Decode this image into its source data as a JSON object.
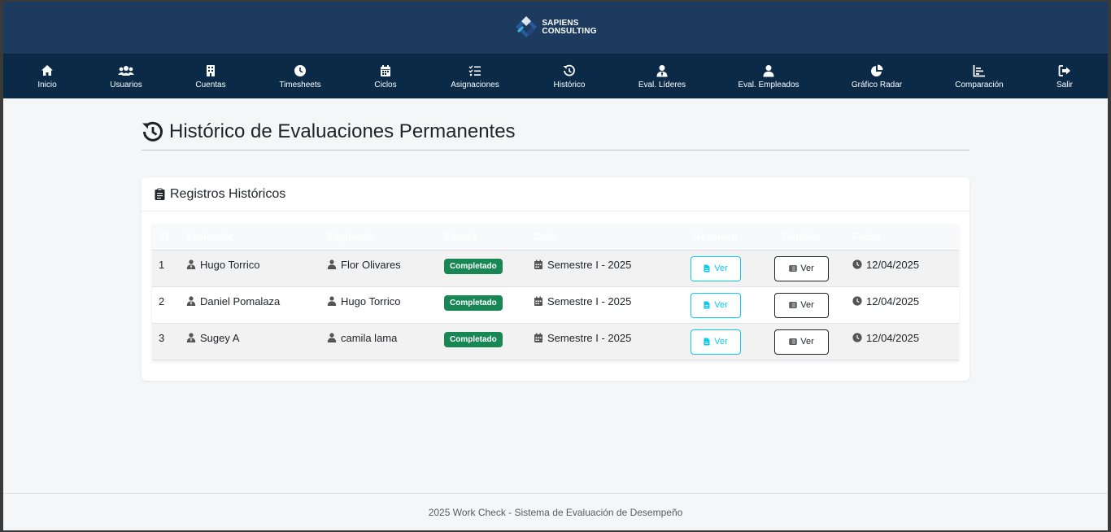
{
  "brand": {
    "line1": "SAPIENS",
    "line2": "CONSULTING"
  },
  "nav": [
    {
      "label": "Inicio",
      "icon": "home-icon"
    },
    {
      "label": "Usuarios",
      "icon": "users-icon"
    },
    {
      "label": "Cuentas",
      "icon": "building-icon"
    },
    {
      "label": "Timesheets",
      "icon": "clock-icon"
    },
    {
      "label": "Ciclos",
      "icon": "calendar-icon"
    },
    {
      "label": "Asignaciones",
      "icon": "list-check-icon"
    },
    {
      "label": "Histórico",
      "icon": "history-icon"
    },
    {
      "label": "Eval. Líderes",
      "icon": "user-tie-icon"
    },
    {
      "label": "Eval. Empleados",
      "icon": "user-icon"
    },
    {
      "label": "Gráfico Radar",
      "icon": "pie-chart-icon"
    },
    {
      "label": "Comparación",
      "icon": "bar-chart-icon"
    },
    {
      "label": "Salir",
      "icon": "logout-icon"
    }
  ],
  "page": {
    "title": "Histórico de Evaluaciones Permanentes"
  },
  "card": {
    "title": "Registros Históricos"
  },
  "table": {
    "headers": [
      "ID",
      "Evaluador",
      "Empleado",
      "Estado",
      "Ciclo",
      "Resumen",
      "Detalles",
      "Fecha"
    ],
    "rows": [
      {
        "id": "1",
        "evaluador": "Hugo Torrico",
        "empleado": "Flor Olivares",
        "estado": "Completado",
        "ciclo": "Semestre I - 2025",
        "resumen": "Ver",
        "detalles": "Ver",
        "fecha": "12/04/2025"
      },
      {
        "id": "2",
        "evaluador": "Daniel Pomalaza",
        "empleado": "Hugo Torrico",
        "estado": "Completado",
        "ciclo": "Semestre I - 2025",
        "resumen": "Ver",
        "detalles": "Ver",
        "fecha": "12/04/2025"
      },
      {
        "id": "3",
        "evaluador": "Sugey A",
        "empleado": "camila lama",
        "estado": "Completado",
        "ciclo": "Semestre I - 2025",
        "resumen": "Ver",
        "detalles": "Ver",
        "fecha": "12/04/2025"
      }
    ]
  },
  "footer": {
    "text": "2025 Work Check - Sistema de Evaluación de Desempeño"
  },
  "colors": {
    "brand_bar": "#1d3a5f",
    "nav_bar": "#0b2a47",
    "badge_success": "#198754",
    "btn_info": "#0dcaf0"
  }
}
